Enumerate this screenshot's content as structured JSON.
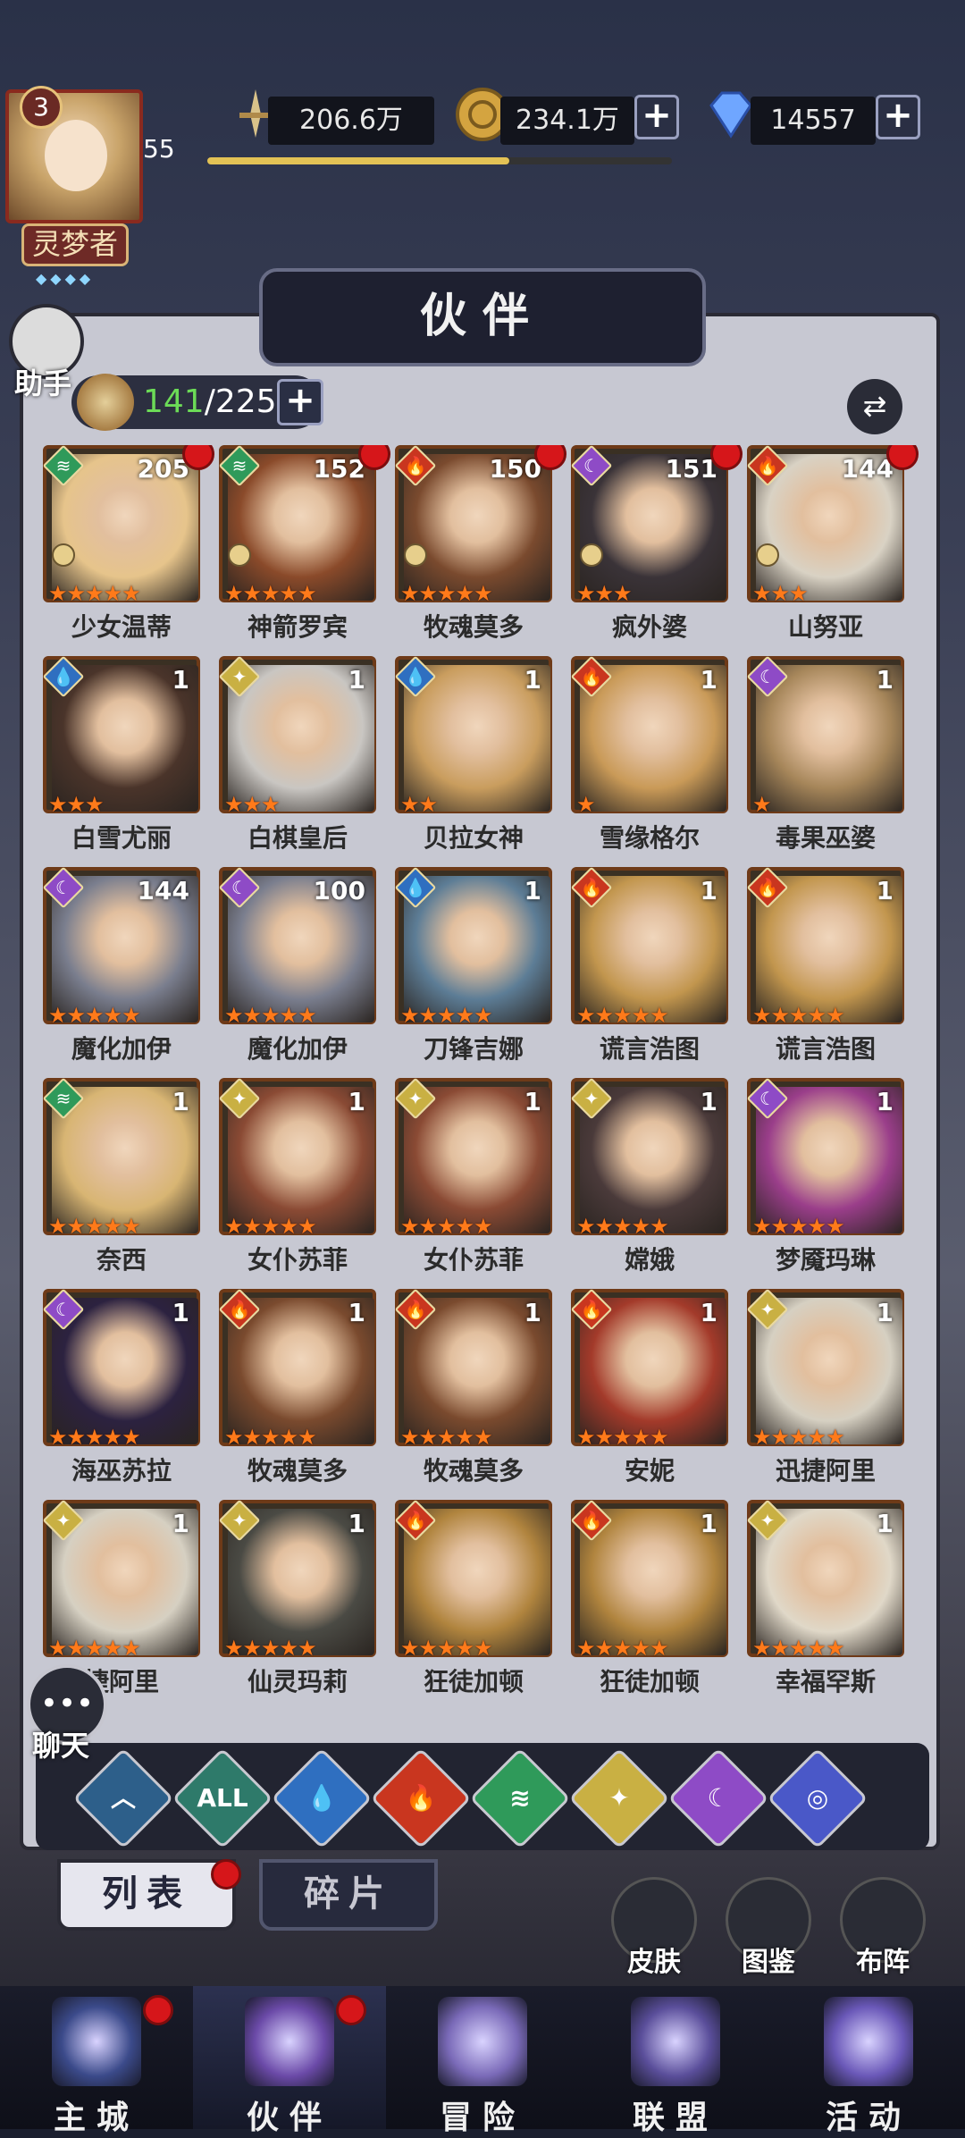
{
  "player": {
    "level": "3",
    "xp_level": "55",
    "title": "灵梦者",
    "xp_progress": 0.65
  },
  "resources": {
    "power": "206.6万",
    "gold": "234.1万",
    "diamonds": "14557"
  },
  "header": {
    "title": "伙伴"
  },
  "assistant": {
    "label": "助手"
  },
  "roster": {
    "owned": "141",
    "capacity": "/225"
  },
  "colors": {
    "fire": "#c9361f",
    "water": "#2f6fc0",
    "wind": "#2f9a5a",
    "light": "#c9b043",
    "dark": "#8e4bc6",
    "cosmic": "#4a58c8",
    "all": "#2e7a6a",
    "basic": "#2d5f8a"
  },
  "companions": [
    {
      "name": "少女温蒂",
      "num": "205",
      "element": "wind",
      "stars": 5,
      "dot": true,
      "rank": true,
      "skin": "#e6c48b"
    },
    {
      "name": "神箭罗宾",
      "num": "152",
      "element": "wind",
      "stars": 5,
      "dot": true,
      "rank": true,
      "skin": "#8a4a2a"
    },
    {
      "name": "牧魂莫多",
      "num": "150",
      "element": "fire",
      "stars": 5,
      "dot": true,
      "rank": true,
      "skin": "#7a4a2e"
    },
    {
      "name": "疯外婆",
      "num": "151",
      "element": "dark",
      "stars": 3,
      "dot": true,
      "rank": true,
      "skin": "#3a3338"
    },
    {
      "name": "山努亚",
      "num": "144",
      "element": "fire",
      "stars": 3,
      "dot": true,
      "rank": true,
      "skin": "#d9d2c4"
    },
    {
      "name": "白雪尤丽",
      "num": "1",
      "element": "water",
      "stars": 3,
      "dot": false,
      "rank": false,
      "skin": "#4a342a"
    },
    {
      "name": "白棋皇后",
      "num": "1",
      "element": "light",
      "stars": 3,
      "dot": false,
      "rank": false,
      "skin": "#c9c6c2"
    },
    {
      "name": "贝拉女神",
      "num": "1",
      "element": "water",
      "stars": 2,
      "dot": false,
      "rank": false,
      "skin": "#c99d5e"
    },
    {
      "name": "雪缘格尔",
      "num": "1",
      "element": "fire",
      "stars": 1,
      "dot": false,
      "rank": false,
      "skin": "#c99a58"
    },
    {
      "name": "毒果巫婆",
      "num": "1",
      "element": "dark",
      "stars": 1,
      "dot": false,
      "rank": false,
      "skin": "#a6865a"
    },
    {
      "name": "魔化加伊",
      "num": "144",
      "element": "dark",
      "stars": 5,
      "dot": false,
      "rank": false,
      "skin": "#7a7e8e"
    },
    {
      "name": "魔化加伊",
      "num": "100",
      "element": "dark",
      "stars": 5,
      "dot": false,
      "rank": false,
      "skin": "#7a7e8e"
    },
    {
      "name": "刀锋吉娜",
      "num": "1",
      "element": "water",
      "stars": 5,
      "dot": false,
      "rank": false,
      "skin": "#5d7d96"
    },
    {
      "name": "谎言浩图",
      "num": "1",
      "element": "fire",
      "stars": 5,
      "dot": false,
      "rank": false,
      "skin": "#c2964e"
    },
    {
      "name": "谎言浩图",
      "num": "1",
      "element": "fire",
      "stars": 5,
      "dot": false,
      "rank": false,
      "skin": "#c2964e"
    },
    {
      "name": "奈西",
      "num": "1",
      "element": "wind",
      "stars": 5,
      "dot": false,
      "rank": false,
      "skin": "#d8b573"
    },
    {
      "name": "女仆苏菲",
      "num": "1",
      "element": "light",
      "stars": 5,
      "dot": false,
      "rank": false,
      "skin": "#8a4a34"
    },
    {
      "name": "女仆苏菲",
      "num": "1",
      "element": "light",
      "stars": 5,
      "dot": false,
      "rank": false,
      "skin": "#8a4a34"
    },
    {
      "name": "嫦娥",
      "num": "1",
      "element": "light",
      "stars": 5,
      "dot": false,
      "rank": false,
      "skin": "#4a3a3a"
    },
    {
      "name": "梦魇玛琳",
      "num": "1",
      "element": "dark",
      "stars": 5,
      "dot": false,
      "rank": false,
      "skin": "#9a3e8a"
    },
    {
      "name": "海巫苏拉",
      "num": "1",
      "element": "dark",
      "stars": 5,
      "dot": false,
      "rank": false,
      "skin": "#2c2240"
    },
    {
      "name": "牧魂莫多",
      "num": "1",
      "element": "fire",
      "stars": 5,
      "dot": false,
      "rank": false,
      "skin": "#7a4a2e"
    },
    {
      "name": "牧魂莫多",
      "num": "1",
      "element": "fire",
      "stars": 5,
      "dot": false,
      "rank": false,
      "skin": "#7a4a2e"
    },
    {
      "name": "安妮",
      "num": "1",
      "element": "fire",
      "stars": 5,
      "dot": false,
      "rank": false,
      "skin": "#a33a2a"
    },
    {
      "name": "迅捷阿里",
      "num": "1",
      "element": "light",
      "stars": 5,
      "dot": false,
      "rank": false,
      "skin": "#d6d0c2"
    },
    {
      "name": "捷阿里",
      "num": "1",
      "element": "light",
      "stars": 5,
      "dot": false,
      "rank": false,
      "skin": "#d6d0c2"
    },
    {
      "name": "仙灵玛莉",
      "num": "1",
      "element": "light",
      "stars": 5,
      "dot": false,
      "rank": false,
      "skin": "#4a4a44"
    },
    {
      "name": "狂徒加顿",
      "num": "",
      "element": "fire",
      "stars": 5,
      "dot": false,
      "rank": false,
      "skin": "#b0843e"
    },
    {
      "name": "狂徒加顿",
      "num": "1",
      "element": "fire",
      "stars": 5,
      "dot": false,
      "rank": false,
      "skin": "#b0843e"
    },
    {
      "name": "幸福罕斯",
      "num": "1",
      "element": "light",
      "stars": 5,
      "dot": false,
      "rank": false,
      "skin": "#e0d8c8"
    }
  ],
  "filters": [
    {
      "key": "basic",
      "label": "︿"
    },
    {
      "key": "all",
      "label": "ALL"
    },
    {
      "key": "water",
      "label": "💧"
    },
    {
      "key": "fire",
      "label": "🔥"
    },
    {
      "key": "wind",
      "label": "≋"
    },
    {
      "key": "light",
      "label": "✦"
    },
    {
      "key": "dark",
      "label": "☾"
    },
    {
      "key": "cosmic",
      "label": "◎"
    }
  ],
  "tabs": {
    "list": "列表",
    "fragments": "碎片"
  },
  "shortcuts": {
    "skin": "皮肤",
    "codex": "图鉴",
    "formation": "布阵"
  },
  "chat": {
    "label": "聊天"
  },
  "nav": [
    {
      "label": "主城",
      "dot": true,
      "color": "#3b4a8a"
    },
    {
      "label": "伙伴",
      "dot": true,
      "color": "#6b4aa8"
    },
    {
      "label": "冒险",
      "dot": false,
      "color": "#7a6ab8"
    },
    {
      "label": "联盟",
      "dot": false,
      "color": "#5a4e9a"
    },
    {
      "label": "活动",
      "dot": false,
      "color": "#6a58b8"
    }
  ]
}
